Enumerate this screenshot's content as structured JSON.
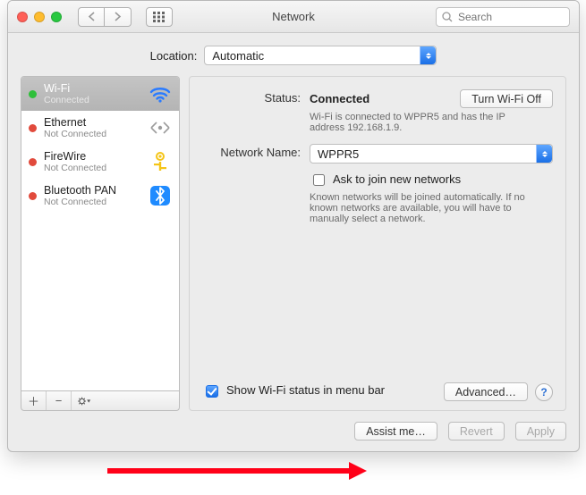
{
  "window": {
    "title": "Network"
  },
  "search": {
    "placeholder": "Search"
  },
  "location": {
    "label": "Location:",
    "value": "Automatic"
  },
  "services": [
    {
      "name": "Wi-Fi",
      "status": "Connected",
      "bullet": "green",
      "icon": "wifi",
      "selected": true
    },
    {
      "name": "Ethernet",
      "status": "Not Connected",
      "bullet": "red",
      "icon": "ethernet",
      "selected": false
    },
    {
      "name": "FireWire",
      "status": "Not Connected",
      "bullet": "red",
      "icon": "firewire",
      "selected": false
    },
    {
      "name": "Bluetooth PAN",
      "status": "Not Connected",
      "bullet": "red",
      "icon": "bluetooth",
      "selected": false
    }
  ],
  "detail": {
    "status_label": "Status:",
    "status_value": "Connected",
    "wifi_toggle_label": "Turn Wi-Fi Off",
    "status_desc": "Wi-Fi is connected to WPPR5 and has the IP address 192.168.1.9.",
    "network_name_label": "Network Name:",
    "network_name_value": "WPPR5",
    "ask_join_label": "Ask to join new networks",
    "ask_join_hint": "Known networks will be joined automatically. If no known networks are available, you will have to manually select a network.",
    "show_status_label": "Show Wi-Fi status in menu bar",
    "advanced_label": "Advanced…"
  },
  "buttons": {
    "assist": "Assist me…",
    "revert": "Revert",
    "apply": "Apply"
  }
}
